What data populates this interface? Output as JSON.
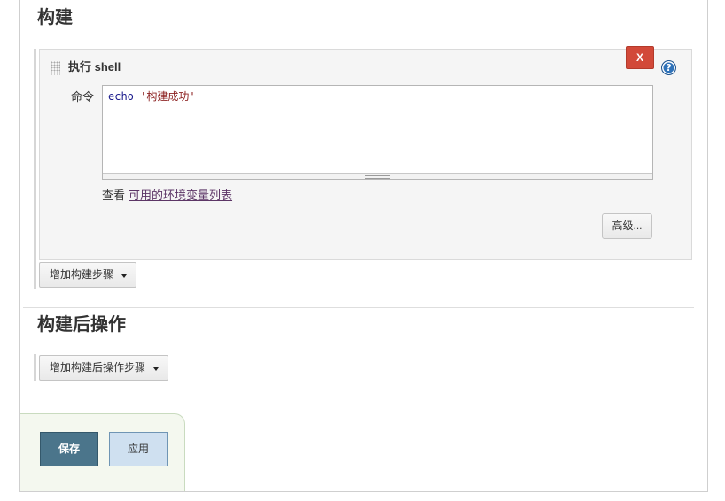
{
  "sections": {
    "build": {
      "title": "构建",
      "step": {
        "title": "执行 shell",
        "delete_label": "X",
        "help_label": "?",
        "command_label": "命令",
        "command": {
          "keyword": "echo",
          "argument": "'构建成功'"
        },
        "env_hint_prefix": "查看",
        "env_link": "可用的环境变量列表",
        "advanced_label": "高级..."
      },
      "add_step_label": "增加构建步骤"
    },
    "post_build": {
      "title": "构建后操作",
      "add_step_label": "增加构建后操作步骤"
    }
  },
  "actions": {
    "save_label": "保存",
    "apply_label": "应用"
  },
  "icons": {
    "drag_handle": "drag-handle-icon",
    "help": "help-icon",
    "dropdown": "chevron-down-icon",
    "resize": "resize-grip-icon"
  },
  "colors": {
    "delete_red": "#d24939",
    "save_blue": "#4b758b",
    "apply_blue": "#cfe0f0",
    "link_purple": "#5c3566",
    "code_keyword": "#1a1a8c",
    "code_string": "#8b1e1e",
    "help_blue": "#2f72b9",
    "save_panel_bg": "#f4f8ef"
  }
}
